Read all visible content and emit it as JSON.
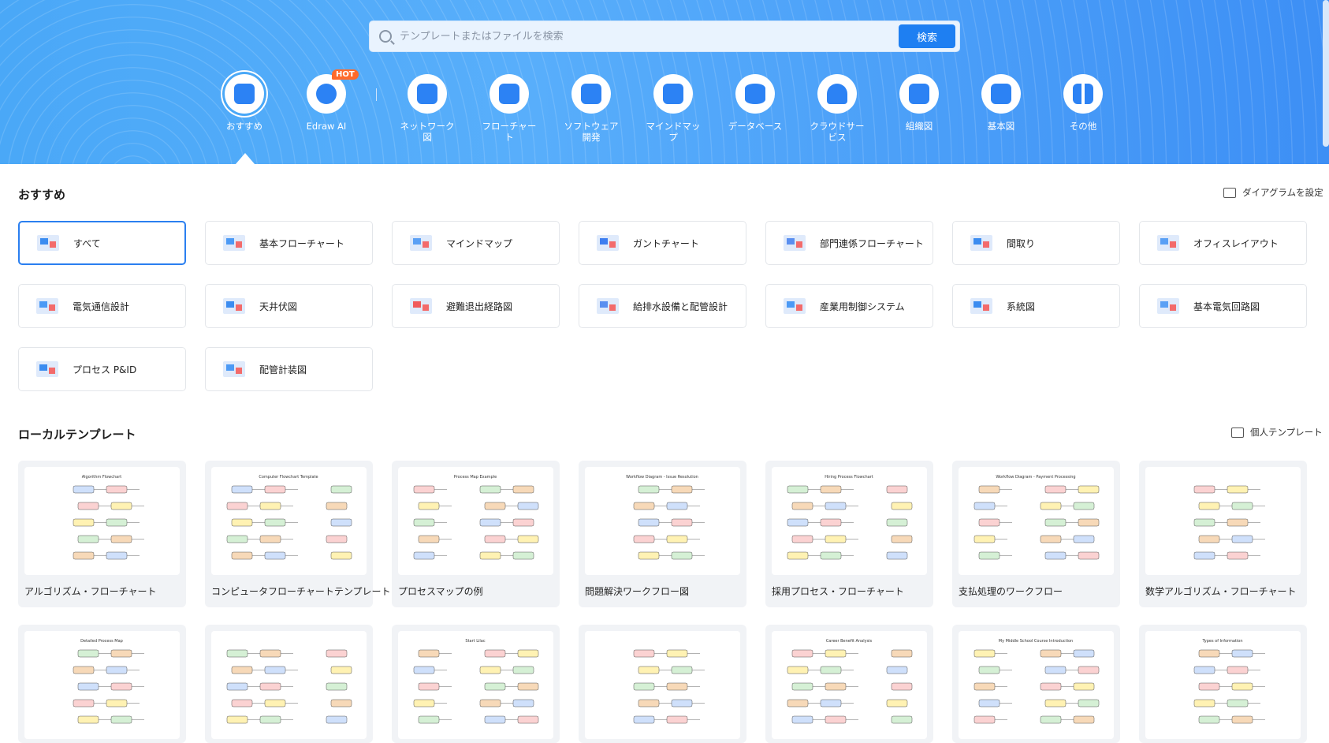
{
  "search": {
    "placeholder": "テンプレートまたはファイルを検索",
    "button": "検索"
  },
  "categories": [
    {
      "label": "おすすめ"
    },
    {
      "label": "Edraw AI",
      "badge": "HOT"
    },
    {
      "label": "ネットワーク図"
    },
    {
      "label": "フローチャート"
    },
    {
      "label": "ソフトウェア開発"
    },
    {
      "label": "マインドマップ"
    },
    {
      "label": "データベース"
    },
    {
      "label": "クラウドサービス"
    },
    {
      "label": "組織図"
    },
    {
      "label": "基本図"
    },
    {
      "label": "その他"
    }
  ],
  "recommended": {
    "title": "おすすめ",
    "action": "ダイアグラムを設定",
    "items": [
      {
        "label": "すべて"
      },
      {
        "label": "基本フローチャート"
      },
      {
        "label": "マインドマップ"
      },
      {
        "label": "ガントチャート"
      },
      {
        "label": "部門連係フローチャート"
      },
      {
        "label": "間取り"
      },
      {
        "label": "オフィスレイアウト"
      },
      {
        "label": "電気通信設計"
      },
      {
        "label": "天井伏図"
      },
      {
        "label": "避難退出経路図"
      },
      {
        "label": "給排水設備と配管設計"
      },
      {
        "label": "産業用制御システム"
      },
      {
        "label": "系統図"
      },
      {
        "label": "基本電気回路図"
      },
      {
        "label": "プロセス P&ID"
      },
      {
        "label": "配管計装図"
      }
    ]
  },
  "local": {
    "title": "ローカルテンプレート",
    "action": "個人テンプレート",
    "cards": [
      {
        "name": "アルゴリズム・フローチャート",
        "thumb_title": "Algorithm Flowchart"
      },
      {
        "name": "コンピュータフローチャートテンプレート",
        "thumb_title": "Computer Flowchart Template"
      },
      {
        "name": "プロセスマップの例",
        "thumb_title": "Process Map Example"
      },
      {
        "name": "問題解決ワークフロー図",
        "thumb_title": "Workflow Diagram - Issue Resolution"
      },
      {
        "name": "採用プロセス・フローチャート",
        "thumb_title": "Hiring Process Flowchart"
      },
      {
        "name": "支払処理のワークフロー",
        "thumb_title": "Workflow Diagram - Payment Processing"
      },
      {
        "name": "数学アルゴリズム・フローチャート",
        "thumb_title": ""
      }
    ],
    "row2_thumb_titles": [
      "Detailed Process Map",
      "",
      "Start Lilac",
      "",
      "Career Benefit Analysis",
      "My Middle School Course Introduction",
      "Types of Information"
    ]
  },
  "colors": {
    "accent": "#2a7ff0",
    "hot": "#ff6a2a",
    "header": "#4aa8f7"
  }
}
